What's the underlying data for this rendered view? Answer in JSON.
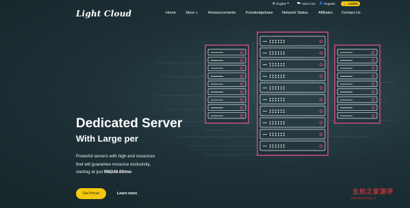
{
  "colors": {
    "accent": "#f4c80d",
    "rack_border": "#d94f8a",
    "background": "#1f3238"
  },
  "topbar": {
    "language": {
      "icon": "globe-icon",
      "label": "English"
    },
    "cart": {
      "icon": "cart-icon",
      "label": "View Cart"
    },
    "register": {
      "icon": "user-plus-icon",
      "label": "Register"
    },
    "login": {
      "icon": "lock-icon",
      "label": "LOGIN"
    }
  },
  "logo": "Light Cloud",
  "nav": {
    "home": "Home",
    "store": "Store",
    "announcements": "Announcements",
    "knowledgebase": "Knowledgebase",
    "network_status": "Network Status",
    "affiliates": "Affiliates",
    "contact": "Contact Us"
  },
  "hero": {
    "title": "Dedicated Server",
    "subtitle": "With Large per",
    "desc_line1": "Powerful servers with high-end resources",
    "desc_line2": "that will guarantee resource exclusivity,",
    "desc_line3_prefix": "starting at just ",
    "desc_price": "RM249.00/mo",
    "cta_primary": "Get Prices",
    "cta_secondary": "Learn more"
  },
  "watermark": {
    "text": "主机之家测评",
    "url": "www.liuzhuomo.cn"
  }
}
